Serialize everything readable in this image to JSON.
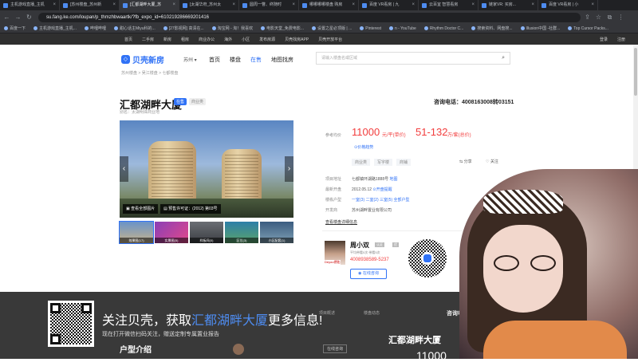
{
  "browser": {
    "tabs": [
      {
        "label": "主机游戏直播_主机"
      },
      {
        "label": "[苏州楼盘_苏州新"
      },
      {
        "label": "[汇都湖畔大厦_苏",
        "active": true
      },
      {
        "label": "[太湖华府_苏州太"
      },
      {
        "label": "圆周一瞥、终随时"
      },
      {
        "label": "哪哪哪哪楼盘 购房"
      },
      {
        "label": "百度 VR看房 | 九"
      },
      {
        "label": "云百宜 智慧看房"
      },
      {
        "label": "链家VR: 买房..."
      },
      {
        "label": "百度 VR看房 | 小"
      }
    ],
    "url": "su.fang.ke.com/loupan/p_thmzhbwaartk/?fb_expo_id=610219286669201416",
    "bookmarks": [
      "百度一下",
      "主机游戏直播_主机...",
      "哔哩哔哩",
      "甜心话主Miyu科的...",
      "[27影视网] 高清在...",
      "淘宝网 - 淘！我喜欢",
      "电影天堂_免费电影...",
      "设置之星必顶版 | ...",
      "Pinterest",
      "n - YouTube",
      "Rhythm Doctor C...",
      "搜索资料、网盘搜...",
      "Illusion中国 -社群...",
      "Top Cursor Packs..."
    ]
  },
  "sitenav": {
    "left": [
      "首页",
      "二手房",
      "新房",
      "租房",
      "商业办公",
      "海外",
      "小区",
      "发布房源",
      "贝壳找房APP",
      "贝壳开放平台"
    ],
    "right": [
      "登录",
      "注册"
    ]
  },
  "header": {
    "logo_text": "贝壳新房",
    "city": "苏州 ▾",
    "nav": [
      "首页",
      "楼盘",
      "在售",
      "地图找房"
    ],
    "search_placeholder": "请输入楼盘名或区域",
    "breadcrumb": "苏州楼盘 > 吴江楼盘 > 七都楼盘"
  },
  "property": {
    "title": "汇都湖畔大厦",
    "status_tag": "在售",
    "type_tag": "商业类",
    "alias": "别名：太湖明珠商业地",
    "hotline": "咨询电话：4008163008转03151"
  },
  "gallery": {
    "prev": "‹",
    "next": "›",
    "btn_view_album": "查看全部图片",
    "btn_cert": "预售许可证：(2012) 第03号",
    "thumbs": [
      "效果图(17)",
      "实景图(5)",
      "样板间(0)",
      "区位(3)",
      "小区配套(1)"
    ]
  },
  "price": {
    "label": "参考均价",
    "avg": "11000",
    "avg_unit": "元/平(单价)",
    "total": "51-132",
    "total_unit": "万/套(总价)",
    "history_link": "⊙价格趋势",
    "tags": [
      "商业类",
      "写字楼",
      "商铺"
    ],
    "share": "⇆ 分享",
    "follow": "♡ 关注"
  },
  "details": [
    {
      "label": "项目地址",
      "value": "七都镇环湖路1888号",
      "link": "地图"
    },
    {
      "label": "最新开盘",
      "value": "2012.05.12",
      "link": "⊙开盘提醒"
    },
    {
      "label": "楼栋户型",
      "value": "",
      "link": "一室(3) 二室(2) 三室(5) 全部户型"
    },
    {
      "label": "开发商",
      "value": "苏州湖畔置业有限公司",
      "link": ""
    }
  ],
  "more_info": "查看楼盘详细信息",
  "agent": {
    "brand": "Deyou德佑",
    "name": "周小双",
    "badge1": "认证",
    "badge2": "优",
    "stats": "平均带看0次  带看5次",
    "phone": "4008938589-5237",
    "consult_btn": "在线咨询"
  },
  "banner": {
    "main_prefix": "关注贝壳，获取",
    "main_highlight": "汇都湖畔大厦",
    "main_suffix": "更多信息!",
    "sub": "现在打开微信扫码关注，赠送定制专属置业报告"
  },
  "background": {
    "unit_type_title": "户型介绍",
    "frag1": "项目概述",
    "frag2": "楼盘动态",
    "frag3": "咨询电话：4008",
    "title2": "汇都湖畔大厦",
    "price2": "11000",
    "btn2": "在线咨询"
  },
  "colors": {
    "brand_blue": "#3072f6",
    "price_red": "#f23d3d",
    "banner_bg": "#282828"
  }
}
